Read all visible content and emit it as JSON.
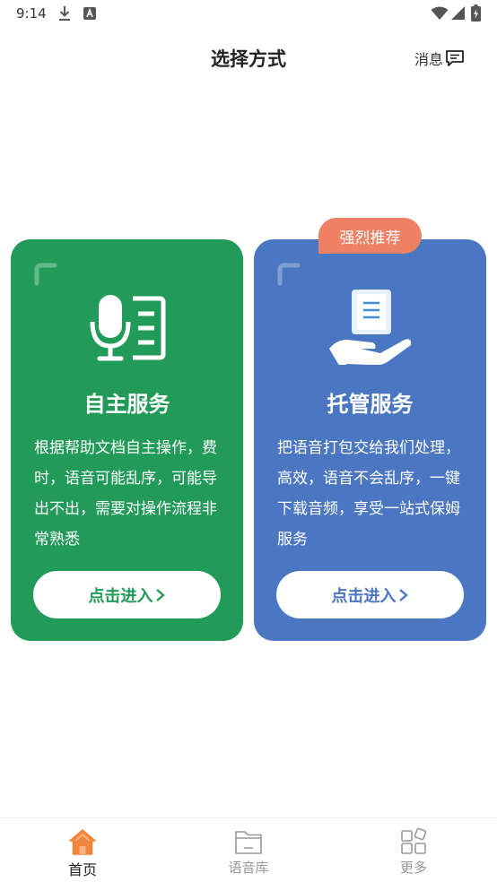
{
  "status_bar": {
    "time": "9:14",
    "icons": [
      "download-icon",
      "a-notification-icon",
      "wifi-icon",
      "signal-icon",
      "battery-icon"
    ]
  },
  "header": {
    "title": "选择方式",
    "message_label": "消息",
    "message_icon": "message-icon"
  },
  "cards": {
    "self_service": {
      "title": "自主服务",
      "description": "根据帮助文档自主操作，费时，语音可能乱序，可能导出不出，需要对操作流程非常熟悉",
      "button_label": "点击进入",
      "icon": "microphone-document-icon",
      "color": "#229b58"
    },
    "managed_service": {
      "badge": "强烈推荐",
      "title": "托管服务",
      "description": "把语音打包交给我们处理，高效，语音不会乱序，一键下载音频，享受一站式保姆服务",
      "button_label": "点击进入",
      "icon": "hand-document-icon",
      "color": "#4a76c2",
      "badge_color": "#ee8163"
    }
  },
  "tab_bar": {
    "items": [
      {
        "label": "首页",
        "icon": "home-icon",
        "active": true,
        "color": "#f5843c"
      },
      {
        "label": "语音库",
        "icon": "folder-icon",
        "active": false
      },
      {
        "label": "更多",
        "icon": "grid-icon",
        "active": false
      }
    ]
  }
}
